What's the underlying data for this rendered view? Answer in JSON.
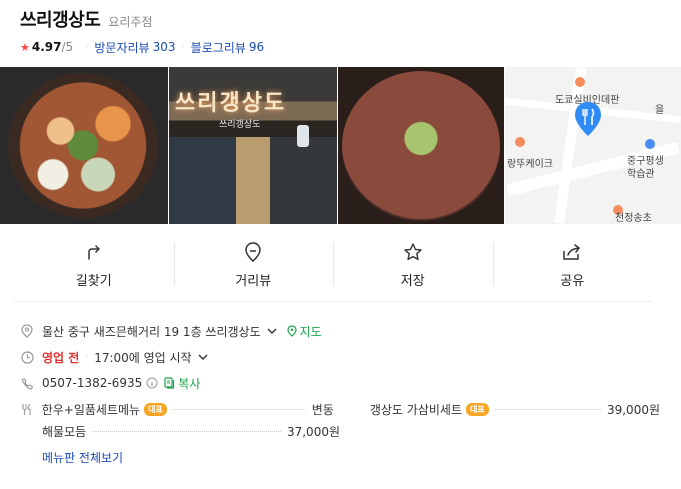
{
  "place": {
    "name": "쓰리갱상도",
    "category": "요리주점",
    "rating": "4.97",
    "rating_max": "/5",
    "visitor_review_label": "방문자리뷰",
    "visitor_review_count": "303",
    "blog_review_label": "블로그리뷰",
    "blog_review_count": "96"
  },
  "photos": {
    "storefront_sign": "쓰리갱상도",
    "storefront_subsign": "쓰리갱상도",
    "map_labels": [
      "도쿄실비인데판",
      "랑뚜케이크",
      "중구평생",
      "학습관",
      "을",
      "천정송초"
    ]
  },
  "actions": [
    {
      "label": "길찾기",
      "icon": "directions-icon"
    },
    {
      "label": "거리뷰",
      "icon": "street-view-icon"
    },
    {
      "label": "저장",
      "icon": "star-icon"
    },
    {
      "label": "공유",
      "icon": "share-icon"
    }
  ],
  "info": {
    "address": "울산 중구 새즈믄해거리 19 1층 쓰리갱상도",
    "map_link": "지도",
    "status": "영업 전",
    "opening_time": "17:00에 영업 시작",
    "phone": "0507-1382-6935",
    "copy_label": "복사"
  },
  "menu": {
    "items": [
      {
        "name": "한우+일품세트메뉴",
        "badge": "대표",
        "price": "변동"
      },
      {
        "name": "갱상도 가삼비세트",
        "badge": "대표",
        "price": "39,000원"
      },
      {
        "name": "해물모듬",
        "badge": "",
        "price": "37,000원"
      }
    ],
    "more_label": "메뉴판 전체보기"
  },
  "colors": {
    "link_blue": "#1b4bb0",
    "green": "#1aa54b",
    "closed_red": "#e03131",
    "badge_orange": "#f6a623",
    "pin_blue": "#2e8bf5"
  }
}
